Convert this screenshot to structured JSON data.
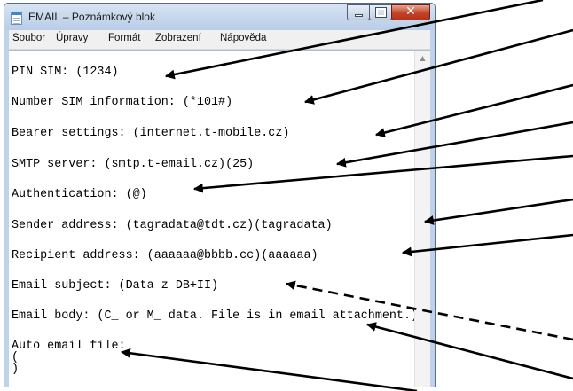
{
  "window": {
    "title": "EMAIL – Poznámkový blok",
    "close_glyph": "✕"
  },
  "menu": [
    "Soubor",
    "Úpravy",
    "Formát",
    "Zobrazení",
    "Nápověda"
  ],
  "editor": {
    "lines": [
      "PIN SIM: (1234)",
      "Number SIM information: (*101#)",
      "Bearer settings: (internet.t-mobile.cz)",
      "SMTP server: (smtp.t-email.cz)(25)",
      "Authentication: (@)",
      "Sender address: (tagradata@tdt.cz)(tagradata)",
      "Recipient address: (aaaaaa@bbbb.cc)(aaaaaa)",
      "Email subject: (Data z DB+II)",
      "Email body: (C_ or M_ data. File is in email attachment.)",
      "Auto email file:",
      "(",
      ")"
    ]
  },
  "scrollbar": {
    "up_arrow": "▲"
  },
  "colors": {
    "title_bar": "#c7d9ef",
    "close_button": "#c2432a",
    "text": "#000000",
    "arrow": "#000000"
  }
}
